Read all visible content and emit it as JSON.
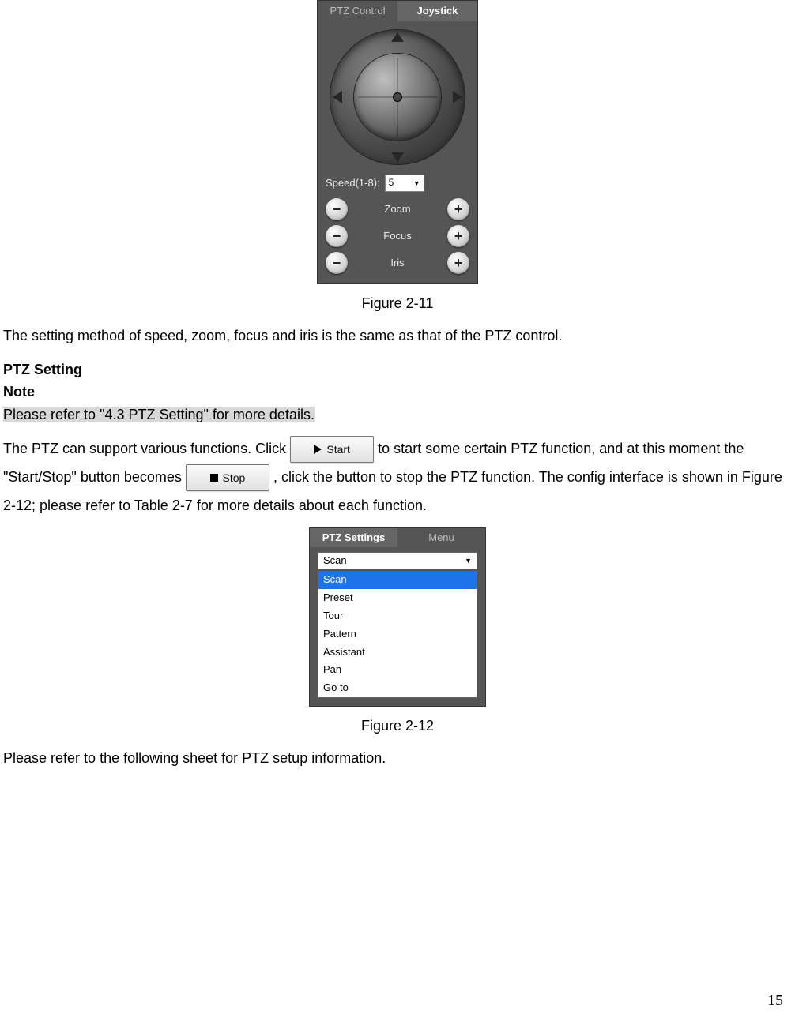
{
  "figure211": {
    "tabs": {
      "ptz": "PTZ Control",
      "joystick": "Joystick"
    },
    "speed_label": "Speed(1-8):",
    "speed_value": "5",
    "controls": {
      "zoom": "Zoom",
      "focus": "Focus",
      "iris": "Iris"
    }
  },
  "caption211": "Figure 2-11",
  "para1": "The setting method of speed, zoom, focus and iris is the same as that of the PTZ control.",
  "heading_ptz_setting": "PTZ Setting",
  "heading_note": "Note",
  "note_line": "Please refer to \"4.3 PTZ Setting\" for more details.",
  "para2a": "The PTZ can support various functions. Click ",
  "start_label": "Start",
  "para2b": " to start some certain PTZ function, and at this moment the \"Start/Stop\" button becomes",
  "stop_label": "Stop",
  "para2c": ", click the button to stop the PTZ function. The config interface is shown in Figure 2-12; please refer to Table 2-7 for more details about each function.",
  "figure212": {
    "tabs": {
      "settings": "PTZ Settings",
      "menu": "Menu"
    },
    "selected": "Scan",
    "options": [
      "Scan",
      "Preset",
      "Tour",
      "Pattern",
      "Assistant",
      "Pan",
      "Go to"
    ]
  },
  "caption212": "Figure 2-12",
  "para3": "Please refer to the following sheet for PTZ setup information.",
  "page_number": "15"
}
